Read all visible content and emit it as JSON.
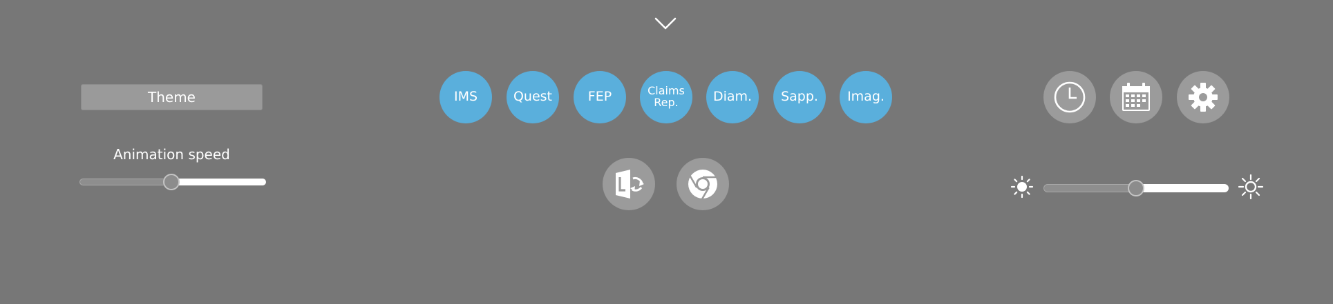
{
  "controls": {
    "theme_label": "Theme",
    "animation_label": "Animation speed",
    "animation_speed": 0.5,
    "brightness": 0.5
  },
  "apps": [
    {
      "label": "IMS"
    },
    {
      "label": "Quest"
    },
    {
      "label": "FEP"
    },
    {
      "label": "Claims Rep."
    },
    {
      "label": "Diam."
    },
    {
      "label": "Sapp."
    },
    {
      "label": "Imag."
    }
  ],
  "icons": {
    "collapse": "chevron-down-icon",
    "lync": "lync-icon",
    "chrome": "chrome-icon",
    "clock": "clock-icon",
    "calendar": "calendar-icon",
    "settings": "gear-icon",
    "brightness_low": "sun-low-icon",
    "brightness_high": "sun-high-icon"
  },
  "colors": {
    "background": "#777777",
    "app_accent": "#5aafdc",
    "gray_button": "#9b9b9b"
  }
}
